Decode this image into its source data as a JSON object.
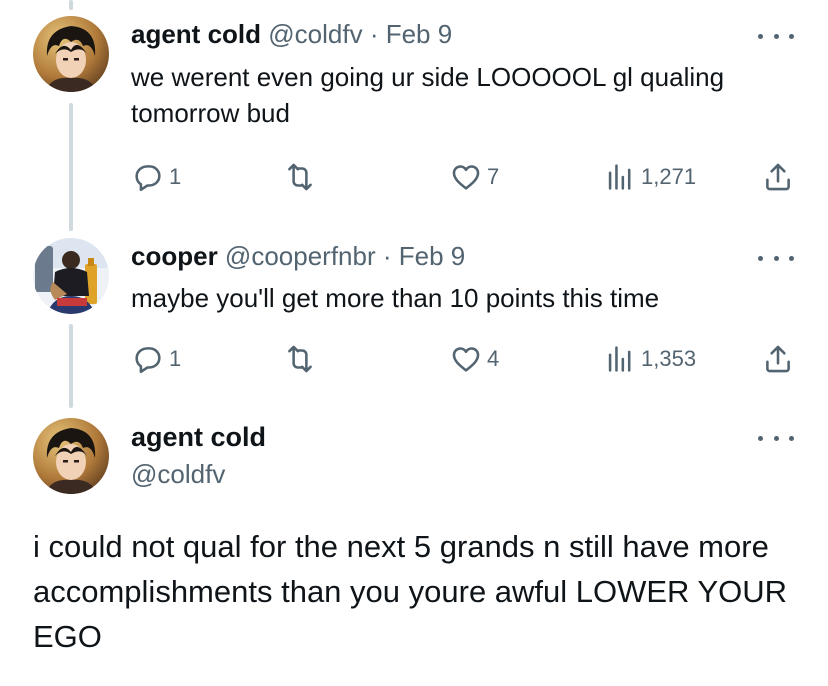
{
  "replies": [
    {
      "name": "agent cold",
      "handle": "@coldfv",
      "separator": "·",
      "date": "Feb 9",
      "text": "we werent even going ur side LOOOOOL gl qualing tomorrow bud",
      "replies_count": "1",
      "retweets_count": "",
      "likes_count": "7",
      "views_count": "1,271"
    },
    {
      "name": "cooper",
      "handle": "@cooperfnbr",
      "separator": "·",
      "date": "Feb 9",
      "text": "maybe you'll get more than 10 points this time",
      "replies_count": "1",
      "retweets_count": "",
      "likes_count": "4",
      "views_count": "1,353"
    }
  ],
  "main_tweet": {
    "name": "agent cold",
    "handle": "@coldfv",
    "text": "i could not qual for the next 5 grands n still have more accomplishments than you youre awful LOWER YOUR EGO"
  },
  "icons": {
    "reply": "reply-icon",
    "retweet": "retweet-icon",
    "like": "heart-icon",
    "views": "views-icon",
    "share": "share-icon",
    "more": "more-icon"
  },
  "colors": {
    "text": "#0f1419",
    "secondary": "#536471",
    "thread_line": "#cfd9de"
  }
}
